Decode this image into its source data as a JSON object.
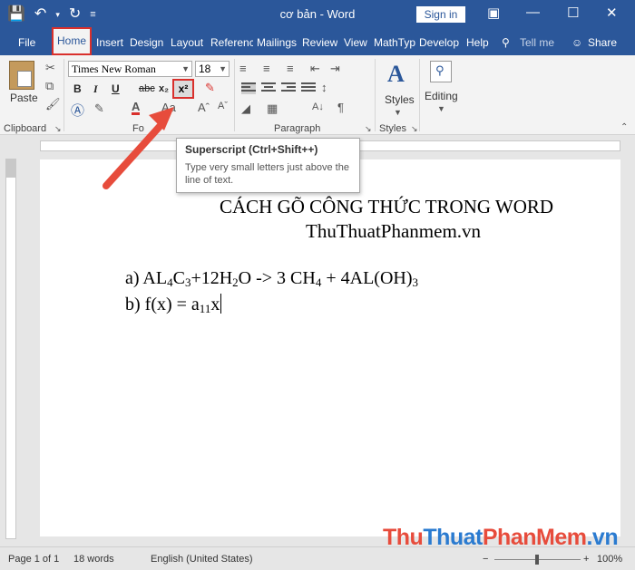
{
  "window": {
    "title": "cơ bản  -  Word",
    "sign_in": "Sign in"
  },
  "tabs": [
    {
      "label": "File"
    },
    {
      "label": "Home"
    },
    {
      "label": "Insert"
    },
    {
      "label": "Design"
    },
    {
      "label": "Layout"
    },
    {
      "label": "Referenc"
    },
    {
      "label": "Mailings"
    },
    {
      "label": "Review"
    },
    {
      "label": "View"
    },
    {
      "label": "MathTyp"
    },
    {
      "label": "Develop"
    },
    {
      "label": "Help"
    }
  ],
  "tell_me": "Tell me",
  "share": "Share",
  "ribbon": {
    "paste": "Paste",
    "font_name": "Times New Roman",
    "font_size": "18",
    "styles": "Styles",
    "editing": "Editing",
    "groups": {
      "clipboard": "Clipboard",
      "font": "Fo",
      "paragraph": "Paragraph",
      "styles": "Styles"
    },
    "bold": "B",
    "italic": "I",
    "underline": "U",
    "strike": "abc",
    "subscript": "x₂",
    "superscript": "x²"
  },
  "tooltip": {
    "title": "Superscript (Ctrl+Shift++)",
    "body": "Type very small letters just above the line of text."
  },
  "document": {
    "heading1": "CÁCH GÕ CÔNG THỨC TRONG WORD",
    "heading2": "ThuThuatPhanmem.vn",
    "line_a": {
      "prefix": "a) AL",
      "s1": "4",
      "t2": "C",
      "s2": "3",
      "t3": "+12H",
      "s3": "2",
      "t4": "O -> 3 CH",
      "s4": "4",
      "t5": " + 4AL(OH)",
      "s5": "3"
    },
    "line_b": {
      "prefix": "b) f(x) = a",
      "s1": "11",
      "t2": "x"
    }
  },
  "status": {
    "page": "Page 1 of 1",
    "words": "18 words",
    "language": "English (United States)",
    "zoom": "100%"
  },
  "watermark": {
    "part1": "Thu",
    "part2": "Thuat",
    "part3": "PhanMem",
    "part4": ".vn"
  },
  "colors": {
    "title_bar": "#2b579a",
    "highlight": "#d9302c",
    "arrow": "#e74c3c"
  },
  "icons": [
    "save-icon",
    "undo-icon",
    "redo-icon",
    "customize-qat-icon",
    "ribbon-display-icon",
    "minimize-icon",
    "maximize-icon",
    "close-icon",
    "lightbulb-icon",
    "person-icon"
  ]
}
